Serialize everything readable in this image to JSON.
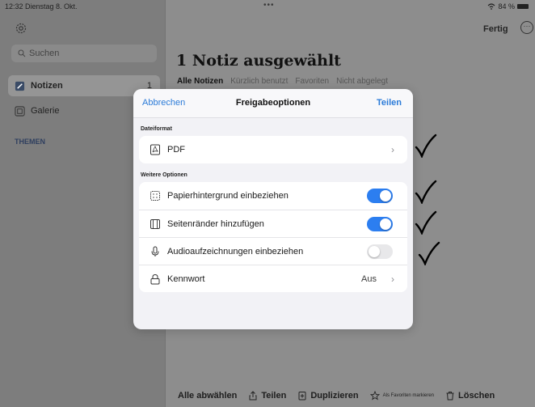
{
  "status_bar": {
    "time_date": "12:32  Dienstag 8. Okt.",
    "dots": "•••",
    "battery": "84 %"
  },
  "sidebar": {
    "search_placeholder": "Suchen",
    "items": [
      {
        "label": "Notizen",
        "count": "1",
        "icon": "note-edit-icon",
        "active": true
      },
      {
        "label": "Galerie",
        "icon": "gallery-icon",
        "active": false
      }
    ],
    "section_title": "THEMEN"
  },
  "header": {
    "done_label": "Fertig",
    "title": "1 Notiz ausgewählt",
    "tabs": [
      "Alle Notizen",
      "Kürzlich benutzt",
      "Favoriten",
      "Nicht abgelegt"
    ]
  },
  "toolbar": {
    "deselect_all": "Alle abwählen",
    "share": "Teilen",
    "duplicate": "Duplizieren",
    "favorite": "Als Favoriten markieren",
    "delete": "Löschen"
  },
  "sheet": {
    "cancel": "Abbrechen",
    "title": "Freigabeoptionen",
    "share": "Teilen",
    "file_format_label": "Dateiformat",
    "file_format_value": "PDF",
    "more_options_label": "Weitere Optionen",
    "options": [
      {
        "label": "Papierhintergrund einbeziehen",
        "enabled": true
      },
      {
        "label": "Seitenränder hinzufügen",
        "enabled": true
      },
      {
        "label": "Audioaufzeichnungen einbeziehen",
        "enabled": false
      }
    ],
    "password_label": "Kennwort",
    "password_value": "Aus"
  },
  "colors": {
    "accent": "#2c7ef0",
    "link": "#2b7bd8",
    "dim_background": "#8d8d8d"
  }
}
